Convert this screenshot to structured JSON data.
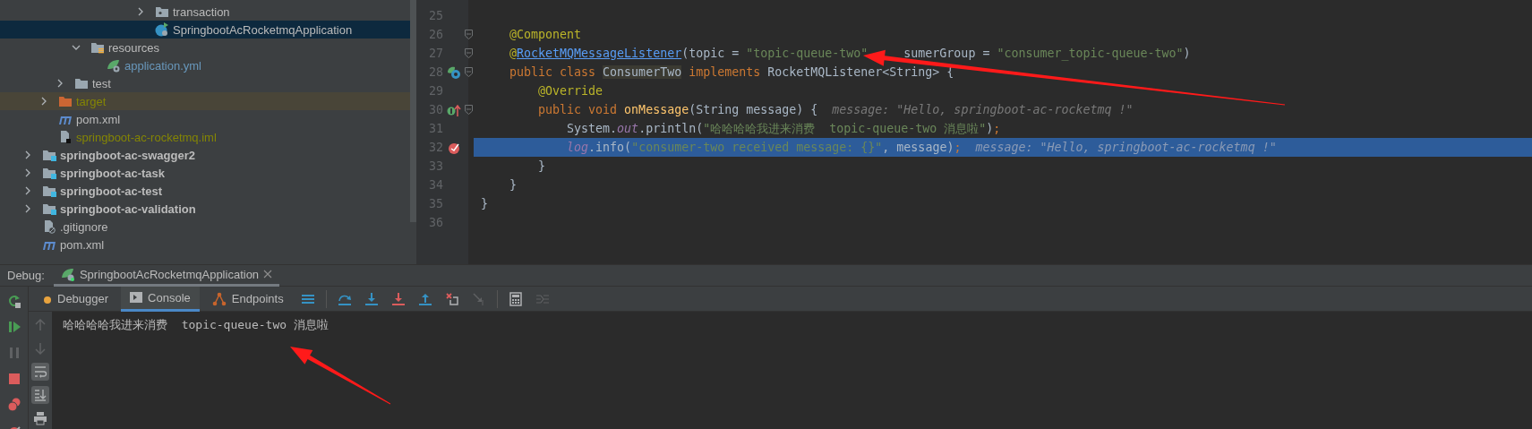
{
  "project_tree": {
    "items": [
      {
        "children": [
          {
            "children": [
              {
                "children": [
                  {
                    "children": [
                      {
                        "children": [
                          {
                            "children": [
                              {
                                "children": [
                                  {
                                    "label": "transaction",
                                    "kind": "package",
                                    "expanded": false,
                                    "selected": false
                                  },
                                  {
                                    "label": "SpringbootAcRocketmqApplication",
                                    "kind": "java-app",
                                    "selected": true
                                  }
                                ]
                              }
                            ]
                          }
                        ]
                      }
                    ]
                  },
                  {
                    "label": "resources",
                    "kind": "resources",
                    "expanded": true,
                    "selected": false,
                    "children": [
                      {
                        "label": "application.yml",
                        "kind": "yaml",
                        "selected": false
                      }
                    ]
                  }
                ]
              },
              {
                "label": "test",
                "kind": "folder",
                "expanded": false,
                "selected": false
              }
            ]
          },
          {
            "label": "target",
            "kind": "excluded",
            "expanded": false,
            "selected": false
          },
          {
            "label": "pom.xml",
            "kind": "maven",
            "selected": false
          },
          {
            "label": "springboot-ac-rocketmq.iml",
            "kind": "iml",
            "selected": false
          }
        ]
      },
      {
        "label": "springboot-ac-swagger2",
        "kind": "module",
        "expanded": false,
        "selected": false
      },
      {
        "label": "springboot-ac-task",
        "kind": "module",
        "expanded": false,
        "selected": false
      },
      {
        "label": "springboot-ac-test",
        "kind": "module",
        "expanded": false,
        "selected": false
      },
      {
        "label": "springboot-ac-validation",
        "kind": "module",
        "expanded": false,
        "selected": false
      },
      {
        "label": ".gitignore",
        "kind": "gitignore",
        "selected": false
      },
      {
        "label": "pom.xml",
        "kind": "maven",
        "selected": false
      }
    ]
  },
  "editor": {
    "lines": [
      {
        "number": "25",
        "fold": false,
        "highlighted": false
      },
      {
        "number": "26",
        "fold": true,
        "highlighted": false,
        "tokens": [
          {
            "kind": "annotation",
            "text": "    @Component"
          }
        ]
      },
      {
        "number": "27",
        "fold": true,
        "highlighted": false,
        "tokens": [
          {
            "kind": "annotation",
            "text": "    @"
          },
          {
            "kind": "link",
            "text": "RocketMQMessageListener"
          },
          {
            "kind": "plain",
            "text": "(topic = "
          },
          {
            "kind": "string",
            "text": "\"topic-queue-two\""
          },
          {
            "kind": "after-cover",
            "text": "sumerGroup = "
          },
          {
            "kind": "string",
            "text": "\"consumer_topic-queue-two\""
          },
          {
            "kind": "plain",
            "text": ")"
          }
        ]
      },
      {
        "number": "28",
        "fold": true,
        "highlighted": false,
        "gutter": {
          "kind": "run"
        },
        "tokens": [
          {
            "kind": "keyword",
            "text": "    public class "
          },
          {
            "kind": "usage",
            "text": "ConsumerTwo"
          },
          {
            "kind": "keyword",
            "text": " implements "
          },
          {
            "kind": "plain",
            "text": "RocketMQListener<String> {"
          }
        ]
      },
      {
        "number": "29",
        "fold": false,
        "highlighted": false,
        "tokens": [
          {
            "kind": "annotation",
            "text": "        @Override"
          }
        ]
      },
      {
        "number": "30",
        "fold": true,
        "highlighted": false,
        "gutter": {
          "kind": "implements"
        },
        "tokens": [
          {
            "kind": "keyword",
            "text": "        public void "
          },
          {
            "kind": "method",
            "text": "onMessage"
          },
          {
            "kind": "plain",
            "text": "(String message) {"
          },
          {
            "kind": "hint",
            "text": "message: \"Hello, springboot-ac-rocketmq !\""
          }
        ]
      },
      {
        "number": "31",
        "fold": false,
        "highlighted": false,
        "tokens": [
          {
            "kind": "plain",
            "text": "            System."
          },
          {
            "kind": "field",
            "text": "out"
          },
          {
            "kind": "plain",
            "text": ".println("
          },
          {
            "kind": "string",
            "text": "\"哈哈哈哈我进来消费  topic-queue-two 消息啦\""
          },
          {
            "kind": "plain",
            "text": ")"
          },
          {
            "kind": "keyword",
            "text": ";"
          }
        ]
      },
      {
        "number": "32",
        "fold": false,
        "highlighted": true,
        "gutter": {
          "kind": "breakpoint"
        },
        "tokens": [
          {
            "kind": "field",
            "text": "            log"
          },
          {
            "kind": "plain",
            "text": ".info("
          },
          {
            "kind": "string",
            "text": "\"consumer-two received message: {}\""
          },
          {
            "kind": "plain",
            "text": ", message)"
          },
          {
            "kind": "keyword",
            "text": ";"
          },
          {
            "kind": "hint",
            "text": "message: \"Hello, springboot-ac-rocketmq !\""
          }
        ]
      },
      {
        "number": "33",
        "fold": false,
        "highlighted": false,
        "tokens": [
          {
            "kind": "plain",
            "text": "        }"
          }
        ]
      },
      {
        "number": "34",
        "fold": false,
        "highlighted": false,
        "tokens": [
          {
            "kind": "plain",
            "text": "    }"
          }
        ]
      },
      {
        "number": "35",
        "fold": false,
        "highlighted": false,
        "tokens": [
          {
            "kind": "plain",
            "text": "}"
          }
        ]
      },
      {
        "number": "36",
        "fold": false,
        "highlighted": false
      }
    ]
  },
  "debug": {
    "label": "Debug:",
    "session": {
      "label": "SpringbootAcRocketmqApplication",
      "selected": true
    },
    "tabs": [
      {
        "label": "Debugger",
        "kind": "debugger",
        "selected": false
      },
      {
        "label": "Console",
        "kind": "console",
        "selected": true
      },
      {
        "label": "Endpoints",
        "kind": "endpoints",
        "selected": false
      }
    ],
    "toolbar": [
      {
        "kind": "frames",
        "disabled": false
      },
      {
        "kind": "step-over",
        "disabled": false
      },
      {
        "kind": "step-into",
        "disabled": false
      },
      {
        "kind": "force-step-into",
        "disabled": false
      },
      {
        "kind": "step-out",
        "disabled": false
      },
      {
        "kind": "drop-frame",
        "disabled": false
      },
      {
        "kind": "run-to-cursor",
        "disabled": true
      },
      {
        "kind": "evaluate",
        "disabled": false
      },
      {
        "kind": "trace",
        "disabled": true
      }
    ],
    "side": [
      {
        "kind": "rerun",
        "disabled": false
      },
      {
        "kind": "resume",
        "disabled": false
      },
      {
        "kind": "pause",
        "disabled": true
      },
      {
        "kind": "stop",
        "disabled": false
      },
      {
        "kind": "breakpoints",
        "disabled": false
      },
      {
        "kind": "mute",
        "disabled": false
      }
    ],
    "console_tools": [
      {
        "kind": "up",
        "on": false
      },
      {
        "kind": "down",
        "on": false
      },
      {
        "kind": "soft-wrap",
        "on": true
      },
      {
        "kind": "scroll-end",
        "on": true
      },
      {
        "kind": "print",
        "on": false
      }
    ],
    "output": [
      "哈哈哈哈我进来消费  topic-queue-two 消息啦"
    ]
  }
}
